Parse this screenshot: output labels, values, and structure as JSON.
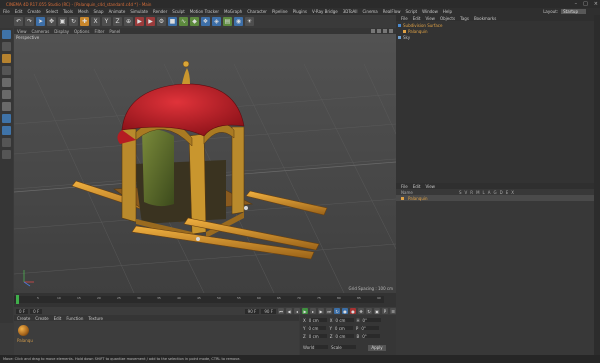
{
  "title": "CINEMA 4D R17.055 Studio (RC) - [Palanquin_c4d_standard.c4d *] - Main",
  "window_controls": [
    "–",
    "□",
    "×"
  ],
  "menu": [
    "File",
    "Edit",
    "Create",
    "Select",
    "Tools",
    "Mesh",
    "Snap",
    "Animate",
    "Simulate",
    "Render",
    "Sculpt",
    "Motion Tracker",
    "MoGraph",
    "Character",
    "Pipeline",
    "Plugins",
    "V-Ray Bridge",
    "3DToAll",
    "Cinema",
    "RealFlow",
    "Script",
    "Window",
    "Help"
  ],
  "layout_label": "Layout:",
  "layout_value": "Startup",
  "viewport_menu": [
    "View",
    "Cameras",
    "Display",
    "Options",
    "Filter",
    "Panel"
  ],
  "viewport_label": "Perspective",
  "grid_spacing": "Grid Spacing : 100 cm",
  "timeline_ticks": [
    "0",
    "5",
    "10",
    "15",
    "20",
    "25",
    "30",
    "35",
    "40",
    "45",
    "50",
    "55",
    "60",
    "65",
    "70",
    "75",
    "80",
    "85",
    "90"
  ],
  "playbar": {
    "start": "0 F",
    "current": "0 F",
    "end": "90 F",
    "end2": "90 F"
  },
  "material_menu": [
    "Create",
    "Create",
    "Edit",
    "Function",
    "Texture"
  ],
  "material_label": "Palanqu",
  "coords": {
    "rows": [
      {
        "a": "X",
        "av": "0 cm",
        "b": "X",
        "bv": "0 cm",
        "c": "H",
        "cv": "0°"
      },
      {
        "a": "Y",
        "av": "0 cm",
        "b": "Y",
        "bv": "0 cm",
        "c": "P",
        "cv": "0°"
      },
      {
        "a": "Z",
        "av": "0 cm",
        "b": "Z",
        "bv": "0 cm",
        "c": "B",
        "cv": "0°"
      }
    ],
    "mode1": "World",
    "mode2": "Scale",
    "apply": "Apply"
  },
  "status": "Move: Click and drag to move elements. Hold down SHIFT to quantize movement / add to the selection in point mode, CTRL to remove.",
  "objects_menu": [
    "File",
    "Edit",
    "View",
    "Objects",
    "Tags",
    "Bookmarks"
  ],
  "objects": [
    "Subdivision Surface",
    "Palanquin",
    "Sky"
  ],
  "attr_menu": [
    "File",
    "Edit",
    "View"
  ],
  "attr_cols": [
    "Name",
    "S",
    "V",
    "R",
    "M",
    "L",
    "A",
    "G",
    "D",
    "E",
    "X"
  ],
  "attr_row": "Palanquin",
  "colors": {
    "accent": "#d76e3a",
    "orange": "#e0a245",
    "green": "#3fae4a",
    "blue": "#3b6ea6"
  }
}
